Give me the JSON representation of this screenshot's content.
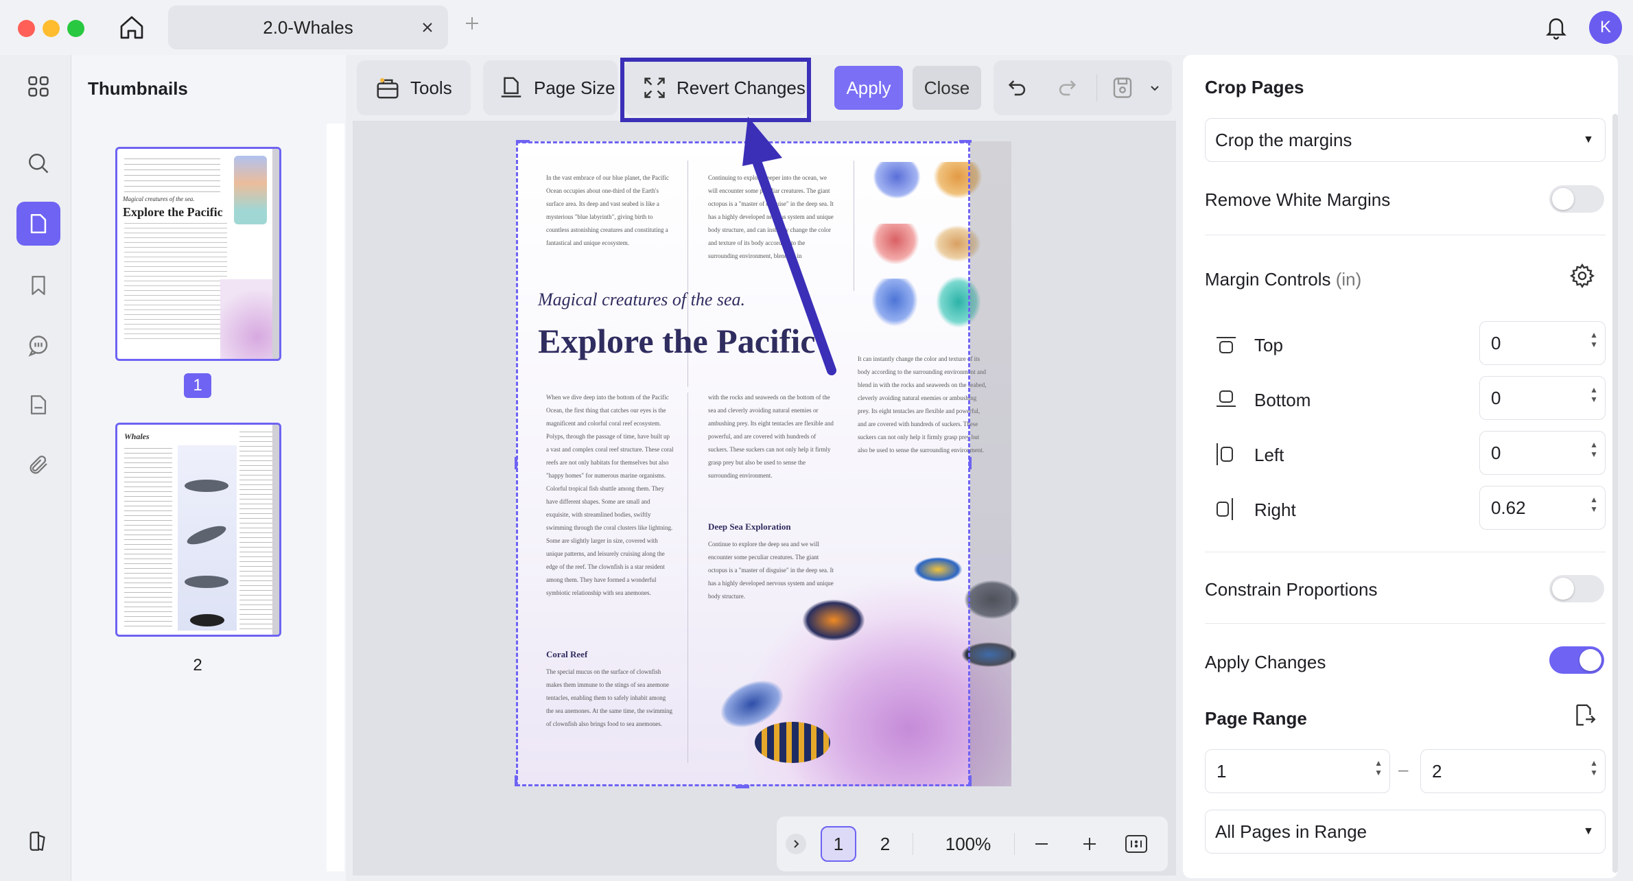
{
  "window": {
    "tab_title": "2.0-Whales",
    "avatar_initial": "K"
  },
  "thumbnails": {
    "title": "Thumbnails",
    "pages": [
      {
        "number": "1",
        "thumb_subtitle": "Magical creatures of the sea.",
        "thumb_title": "Explore the Pacific"
      },
      {
        "number": "2",
        "thumb_title": "Whales"
      }
    ]
  },
  "toolbar": {
    "tools": "Tools",
    "page_size": "Page Size",
    "revert_changes": "Revert Changes",
    "apply": "Apply",
    "close": "Close"
  },
  "document": {
    "col1_intro": "In the vast embrace of our blue planet, the Pacific Ocean occupies about one-third of the Earth's surface area. Its deep and vast seabed is like a mysterious \"blue labyrinth\", giving birth to countless astonishing creatures and constituting a fantastical and unique ecosystem.",
    "col2_intro": "Continuing to explore deeper into the ocean, we will encounter some peculiar creatures. The giant octopus is a \"master of disguise\" in the deep sea. It has a highly developed nervous system and unique body structure, and can instantly change the color and texture of its body according to the surrounding environment, blending in",
    "subtitle": "Magical creatures of the sea.",
    "title": "Explore the Pacific",
    "col3_side": "It can instantly change the color and texture of its body according to the surrounding environment and blend in with the rocks and seaweeds on the seabed, cleverly avoiding natural enemies or ambushing prey. Its eight tentacles are flexible and powerful, and are covered with hundreds of suckers. These suckers can not only help it firmly grasp prey but also be used to sense the surrounding environment.",
    "col1_body": "When we dive deep into the bottom of the Pacific Ocean, the first thing that catches our eyes is the magnificent and colorful coral reef ecosystem. Polyps, through the passage of time, have built up a vast and complex coral reef structure. These coral reefs are not only habitats for themselves but also \"happy homes\" for numerous marine organisms. Colorful tropical fish shuttle among them. They have different shapes. Some are small and exquisite, with streamlined bodies, swiftly swimming through the coral clusters like lightning. Some are slightly larger in size, covered with unique patterns, and leisurely cruising along the edge of the reef. The clownfish is a star resident among them. They have formed a wonderful symbiotic relationship with sea anemones.",
    "col2_body": "with the rocks and seaweeds on the bottom of the sea and cleverly avoiding natural enemies or ambushing prey. Its eight tentacles are flexible and powerful, and are covered with hundreds of suckers. These suckers can not only help it firmly grasp prey but also be used to sense the surrounding environment.",
    "section_deep": "Deep Sea Exploration",
    "col2_deep": "Continue to explore the deep sea and we will encounter some peculiar creatures. The giant octopus is a \"master of disguise\" in the deep sea. It has a highly developed nervous system and unique body structure.",
    "section_coral": "Coral Reef",
    "col1_coral": "The special mucus on the surface of clownfish makes them immune to the stings of sea anemone tentacles, enabling them to safely inhabit among the sea anemones. At the same time, the swimming of clownfish also brings food to sea anemones."
  },
  "pager": {
    "pages": [
      "1",
      "2"
    ],
    "current_page": "1",
    "zoom": "100%"
  },
  "crop_panel": {
    "title": "Crop Pages",
    "mode_selected": "Crop the margins",
    "remove_white_margins": {
      "label": "Remove White Margins",
      "enabled": false
    },
    "margin_controls": {
      "label": "Margin Controls",
      "unit": "(in)",
      "top": {
        "label": "Top",
        "value": "0"
      },
      "bottom": {
        "label": "Bottom",
        "value": "0"
      },
      "left": {
        "label": "Left",
        "value": "0"
      },
      "right": {
        "label": "Right",
        "value": "0.62"
      }
    },
    "constrain_proportions": {
      "label": "Constrain Proportions",
      "enabled": false
    },
    "apply_changes": {
      "label": "Apply Changes",
      "enabled": true
    },
    "page_range": {
      "label": "Page Range",
      "from": "1",
      "separator": "–",
      "to": "2",
      "scope_selected": "All Pages in Range"
    }
  },
  "colors": {
    "accent": "#6e63f3",
    "annotation": "#3b2fb8"
  }
}
